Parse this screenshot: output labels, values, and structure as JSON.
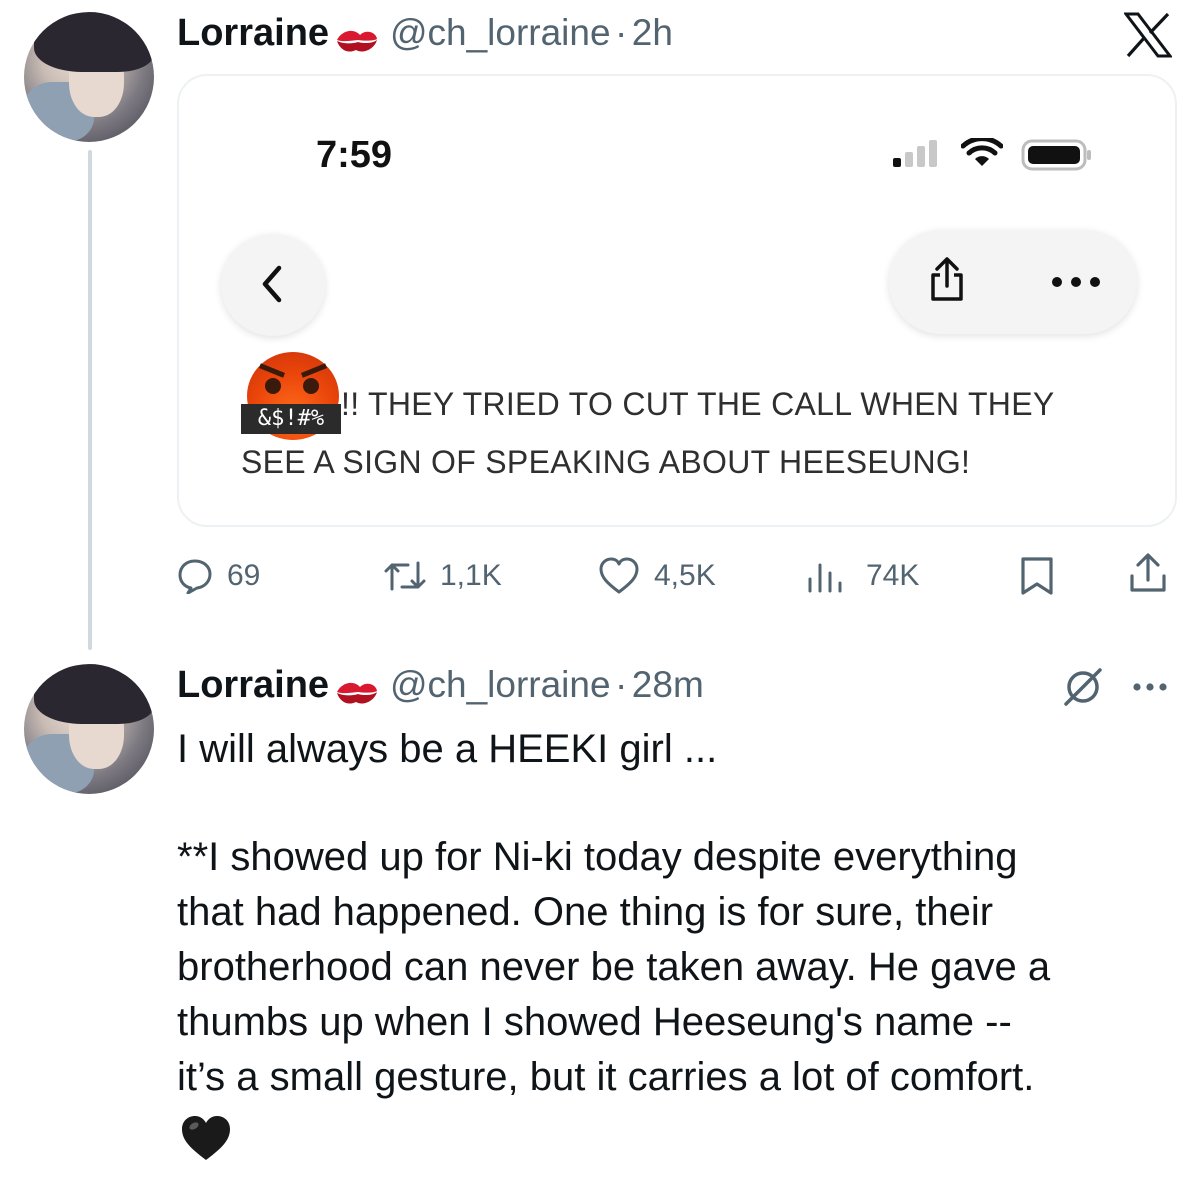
{
  "post1": {
    "author_name": "Lorraine",
    "handle": "@ch_lorraine",
    "separator": "·",
    "time": "2h",
    "embedded_screenshot": {
      "status_time": "7:59",
      "text_lead": "!! THEY TRIED TO CUT THE CALL WHEN THEY",
      "text_line2": "SEE A SIGN OF SPEAKING ABOUT HEESEUNG!",
      "emoji_label": "&$!#%"
    },
    "actions": {
      "replies": "69",
      "reposts": "1,1K",
      "likes": "4,5K",
      "views": "74K"
    }
  },
  "post2": {
    "author_name": "Lorraine",
    "handle": "@ch_lorraine",
    "separator": "·",
    "time": "28m",
    "line1": "I will always be a HEEKI girl ...",
    "para": [
      "**I showed up for Ni-ki today despite everything",
      "that had happened. One thing is for sure, their",
      "brotherhood can never be taken away. He gave a",
      "thumbs up when I showed Heeseung's name --",
      "it’s a small gesture, but it carries a lot of comfort."
    ],
    "heart_emoji": "🖤"
  },
  "icons": [
    "x-logo-icon",
    "kiss-emoji-icon",
    "back-chevron-icon",
    "share-icon",
    "more-dots-icon",
    "reply-icon",
    "repost-icon",
    "like-icon",
    "views-icon",
    "bookmark-icon",
    "upload-icon",
    "grok-icon",
    "signal-icon",
    "wifi-icon",
    "battery-icon"
  ],
  "colors": {
    "text": "#0f1419",
    "secondary": "#536471",
    "thread_line": "#cfd9de",
    "card_border": "#eef1f3"
  }
}
